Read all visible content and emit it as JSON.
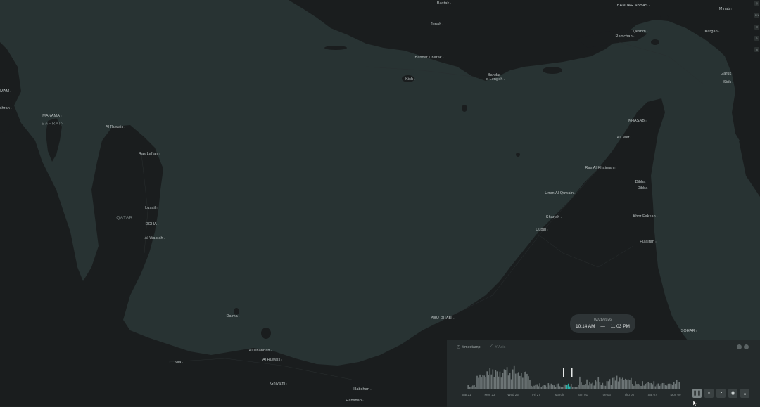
{
  "map_labels": [
    {
      "text": "Bastak",
      "kind": "city"
    },
    {
      "text": "BANDAR ABBAS",
      "kind": "city"
    },
    {
      "text": "Minab",
      "kind": "city"
    },
    {
      "text": "Jenah",
      "kind": "city"
    },
    {
      "text": "Qeshm",
      "kind": "city"
    },
    {
      "text": "Ramchah",
      "kind": "city"
    },
    {
      "text": "Kargan",
      "kind": "city"
    },
    {
      "text": "Bandar Charak",
      "kind": "city"
    },
    {
      "text": "Kish",
      "kind": "city"
    },
    {
      "text": "Bandar-",
      "kind": "city"
    },
    {
      "text": "e Lengeh",
      "kind": "city"
    },
    {
      "text": "Garuk",
      "kind": "city"
    },
    {
      "text": "Sirik",
      "kind": "city"
    },
    {
      "text": "MAM",
      "kind": "city"
    },
    {
      "text": "ahran",
      "kind": "city"
    },
    {
      "text": "MANAMA",
      "kind": "city"
    },
    {
      "text": "BAHRAIN",
      "kind": "country"
    },
    {
      "text": "Al Ruwais",
      "kind": "city"
    },
    {
      "text": "KHASAB",
      "kind": "city"
    },
    {
      "text": "Al Jeer",
      "kind": "city"
    },
    {
      "text": "Ras Laffan",
      "kind": "city"
    },
    {
      "text": "Ras Al Khaimah",
      "kind": "city"
    },
    {
      "text": "Dibba",
      "kind": "city"
    },
    {
      "text": "Dibba",
      "kind": "city"
    },
    {
      "text": "Umm Al Quwain",
      "kind": "city"
    },
    {
      "text": "Lusail",
      "kind": "city"
    },
    {
      "text": "QATAR",
      "kind": "country"
    },
    {
      "text": "Sharjah",
      "kind": "city"
    },
    {
      "text": "Khor Fakkan",
      "kind": "city"
    },
    {
      "text": "DOHA",
      "kind": "city"
    },
    {
      "text": "Dubai",
      "kind": "city"
    },
    {
      "text": "Al Wakrah",
      "kind": "city"
    },
    {
      "text": "Fujairah",
      "kind": "city"
    },
    {
      "text": "Dalma",
      "kind": "city"
    },
    {
      "text": "ABU DHABI",
      "kind": "city"
    },
    {
      "text": "SOHAR",
      "kind": "city"
    },
    {
      "text": "Al Dhannah",
      "kind": "city"
    },
    {
      "text": "Sila",
      "kind": "city"
    },
    {
      "text": "Al Ruwais",
      "kind": "city"
    },
    {
      "text": "Ghiyathi",
      "kind": "city"
    },
    {
      "text": "Habshan",
      "kind": "city"
    },
    {
      "text": "Habshan",
      "kind": "city"
    }
  ],
  "toolbar": {
    "items": [
      "layers-icon",
      "language-toggle",
      "legend-icon",
      "measure-icon",
      "split-map-icon"
    ],
    "language_label": "EN"
  },
  "time_window": {
    "date": "02/28/2026",
    "start": "10:14 AM",
    "separator": "—",
    "end": "11:03 PM"
  },
  "timeline": {
    "field_label": "timestamp",
    "y_axis_label": "Y Axis",
    "ticks": [
      "Sat 21",
      "Mon 23",
      "Wed 25",
      "Fri 27",
      "March",
      "Sun 01",
      "Tue 03",
      "Thu 05",
      "Sat 07",
      "Mon 09"
    ],
    "controls": [
      "pause-button",
      "loop-button",
      "speed-button",
      "animation-window-button",
      "export-button"
    ]
  },
  "colors": {
    "water": "#283333",
    "land": "#1a1d1e",
    "histogram_bar": "#6c7475",
    "histogram_selected": "#2bb0a6"
  }
}
